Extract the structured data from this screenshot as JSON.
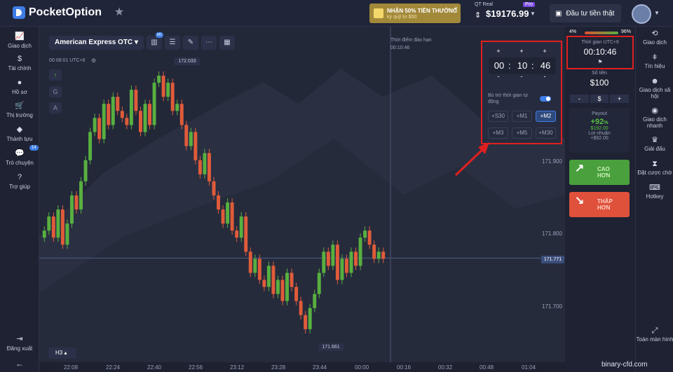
{
  "header": {
    "logo_text": "PocketOption",
    "promo_line1": "NHẬN 50% TIỀN THƯỞNG",
    "promo_line2": "ký quỹ từ $50",
    "account_label": "QT Real",
    "balance": "$19176.99",
    "pro_badge": "Pro",
    "real_button": "Đầu tư tiền thật"
  },
  "left_nav": [
    {
      "label": "Giao dịch",
      "icon": "chart-icon"
    },
    {
      "label": "Tài chính",
      "icon": "dollar-icon"
    },
    {
      "label": "Hồ sơ",
      "icon": "user-icon"
    },
    {
      "label": "Thị trường",
      "icon": "cart-icon"
    },
    {
      "label": "Thành tựu",
      "icon": "diamond-icon"
    },
    {
      "label": "Trò chuyện",
      "icon": "chat-icon",
      "badge": "14"
    },
    {
      "label": "Trợ giúp",
      "icon": "help-icon"
    },
    {
      "label": "Đăng xuất",
      "icon": "logout-icon"
    }
  ],
  "toolbar": {
    "asset": "American Express OTC",
    "m1": "M1"
  },
  "chart_info": {
    "clock": "00:08:01 UTC+6",
    "side_buttons": [
      "↑",
      "G",
      "A"
    ],
    "expiry_label": "Thời điểm đáo hạn",
    "expiry_time": "00:10:46",
    "timeframe": "H3",
    "high_label": "172.033",
    "low_label": "171.661",
    "current_price": "171.771",
    "y_ticks": [
      "171.900",
      "171.800",
      "171.700"
    ],
    "x_ticks": [
      "22:08",
      "22:24",
      "22:40",
      "22:56",
      "23:12",
      "23:28",
      "23:44",
      "00:00",
      "00:16",
      "00:32",
      "00:48",
      "01:04"
    ]
  },
  "time_panel": {
    "hours": "00",
    "minutes": "10",
    "seconds": "46",
    "auto_label": "Bù trừ thời gian tự động",
    "quick": [
      "+S30",
      "+M1",
      "+M2",
      "+M3",
      "+M5",
      "+M30"
    ],
    "active": "+M2"
  },
  "right_panel": {
    "left_pct": "4%",
    "right_pct": "96%",
    "time_label": "Thời gian UTC+6",
    "time_value": "00:10:46",
    "amount_label": "Số tiền",
    "amount": "$100",
    "payout_label": "Payout",
    "payout_pct": "+92",
    "payout_pct_sign": "%",
    "payout_amount": "$192.00",
    "profit_label": "Lợi nhuận",
    "profit_amount": "+$92.00",
    "buy_label1": "CAO",
    "buy_label2": "HƠN",
    "sell_label1": "THẤP",
    "sell_label2": "HƠN"
  },
  "right_nav": [
    {
      "label": "Giao dịch"
    },
    {
      "label": "Tín hiệu"
    },
    {
      "label": "Giao dịch xã hội"
    },
    {
      "label": "Giao dịch nhanh"
    },
    {
      "label": "Giải đấu"
    },
    {
      "label": "Đặt cược chờ"
    },
    {
      "label": "Hotkey"
    },
    {
      "label": "Toàn màn hình"
    }
  ],
  "watermark": "binary-cfd.com",
  "colors": {
    "up": "#58b040",
    "down": "#e05b3a",
    "accent": "#3f7de6",
    "highlight": "#e02020"
  },
  "chart_data": {
    "type": "candlestick",
    "y_range": [
      171.65,
      172.04
    ],
    "closes": [
      171.81,
      171.83,
      171.8,
      171.84,
      171.79,
      171.82,
      171.86,
      171.84,
      171.88,
      171.91,
      171.95,
      171.97,
      171.94,
      171.99,
      171.96,
      172.0,
      171.98,
      171.97,
      171.96,
      172.01,
      171.98,
      171.95,
      171.99,
      171.96,
      172.02,
      172.03,
      172.0,
      172.02,
      171.98,
      171.99,
      171.96,
      171.93,
      171.95,
      171.91,
      171.89,
      171.92,
      171.88,
      171.86,
      171.84,
      171.82,
      171.85,
      171.81,
      171.8,
      171.83,
      171.78,
      171.75,
      171.77,
      171.74,
      171.73,
      171.76,
      171.72,
      171.74,
      171.71,
      171.75,
      171.73,
      171.71,
      171.69,
      171.67,
      171.7,
      171.72,
      171.75,
      171.78,
      171.76,
      171.79,
      171.74,
      171.77,
      171.75,
      171.78,
      171.76,
      171.8,
      171.81,
      171.79,
      171.77,
      171.78,
      171.77
    ]
  }
}
